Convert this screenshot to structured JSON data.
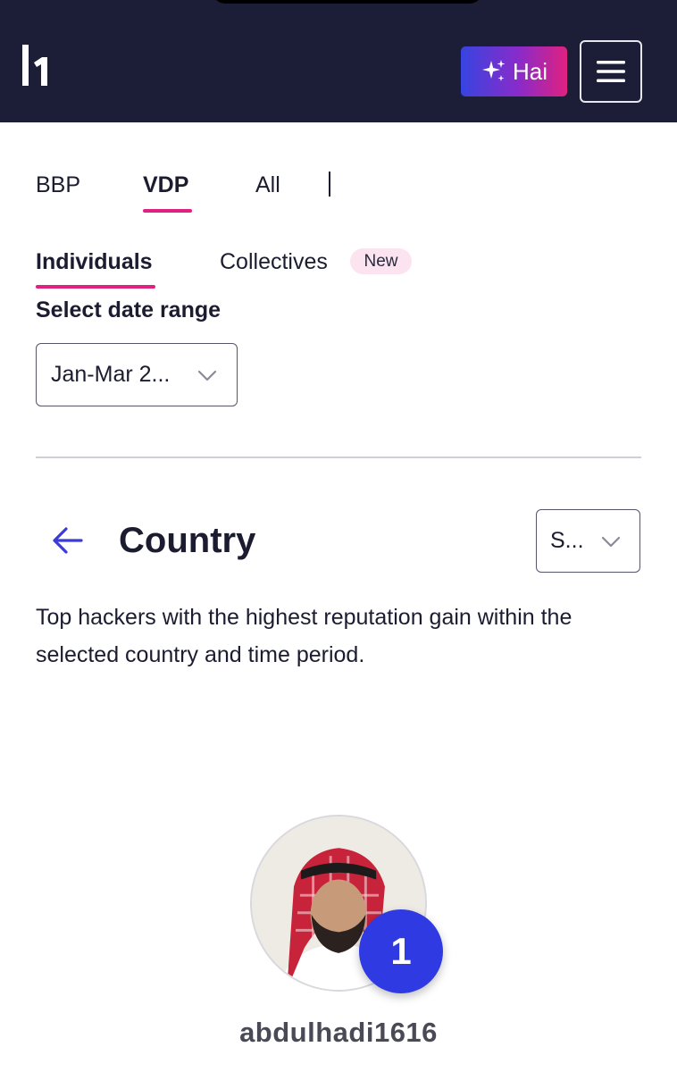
{
  "header": {
    "logo_icon": "hackerone-h1-logo-icon",
    "ai_button": {
      "label": "Hai",
      "icon": "sparkle-icon"
    },
    "menu_icon": "hamburger-menu-icon"
  },
  "program_tabs": [
    {
      "label": "BBP",
      "active": false
    },
    {
      "label": "VDP",
      "active": true
    },
    {
      "label": "All",
      "active": false
    }
  ],
  "type_tabs": [
    {
      "label": "Individuals",
      "active": true
    },
    {
      "label": "Collectives",
      "active": false,
      "badge": "New"
    }
  ],
  "date_range": {
    "label": "Select date range",
    "value": "Jan-Mar 2..."
  },
  "section": {
    "title": "Country",
    "country_select_value": "S...",
    "description": "Top hackers with the highest reputation gain within the selected country and time period."
  },
  "leaderboard": [
    {
      "rank": "1",
      "username": "abdulhadi1616"
    }
  ],
  "colors": {
    "header_bg": "#1c1d36",
    "accent_pink": "#e0217f",
    "rank_badge": "#2f3ae3"
  }
}
